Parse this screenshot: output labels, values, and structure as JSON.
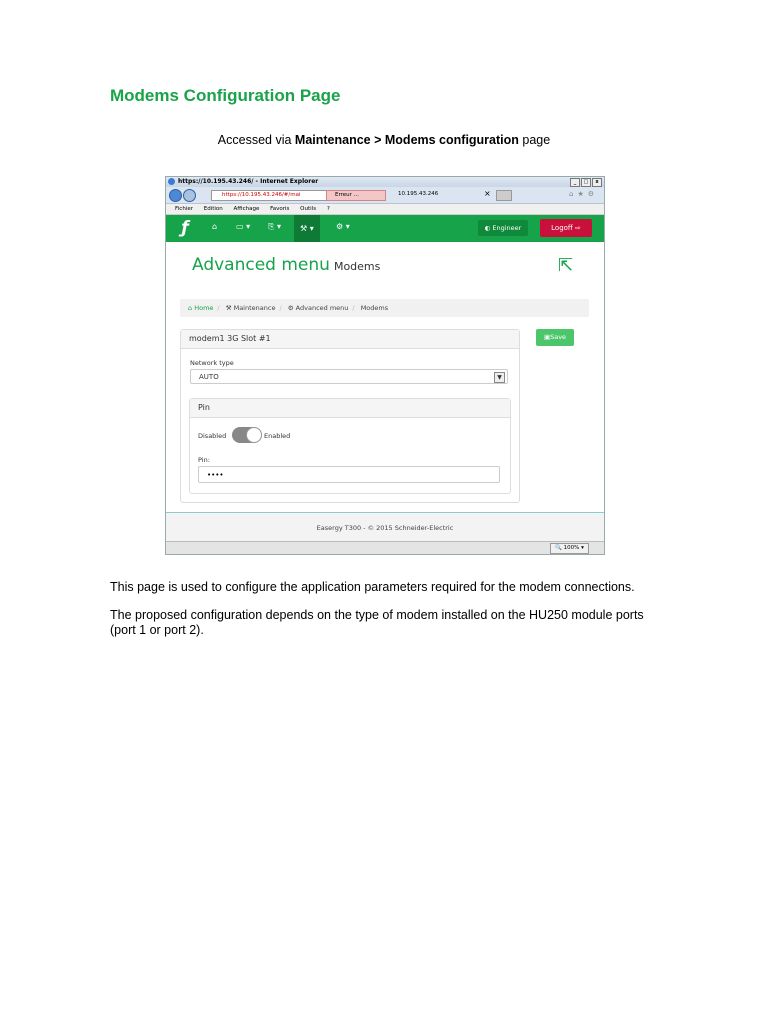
{
  "doc": {
    "title": "Modems Configuration Page",
    "access_prefix": "Accessed via ",
    "access_bold": "Maintenance > Modems configuration",
    "access_suffix": " page",
    "para1": "This page is used to configure the application parameters required for the modem connections.",
    "para2": "The proposed configuration depends on the type of modem installed on the HU250 module ports (port 1 or port 2)."
  },
  "browser": {
    "title": "https://10.195.43.246/ - Internet Explorer",
    "url": "https://10.195.43.246/#/mai",
    "error_tab": "Erreur ...",
    "ip_tab": "10.195.43.246",
    "tab_close": "×",
    "menu": [
      "Fichier",
      "Edition",
      "Affichage",
      "Favoris",
      "Outils",
      "?"
    ],
    "zoom": "100%"
  },
  "app": {
    "engineer_label": "Engineer",
    "logoff_label": "Logoff",
    "page_title": "Advanced menu",
    "page_subtitle": "Modems",
    "breadcrumb": [
      "Home",
      "Maintenance",
      "Advanced menu",
      "Modems"
    ],
    "panel_title": "modem1  3G  Slot #1",
    "network_type_label": "Network type",
    "network_type_value": "AUTO",
    "pin_section_title": "Pin",
    "toggle_disabled": "Disabled",
    "toggle_enabled": "Enabled",
    "pin_label": "Pin:",
    "pin_value": "••••",
    "save_label": "Save",
    "footer": "Easergy T300 - © 2015 Schneider-Electric"
  },
  "colors": {
    "accent": "#16a34a",
    "danger": "#c8103a",
    "save": "#4cc66b"
  }
}
